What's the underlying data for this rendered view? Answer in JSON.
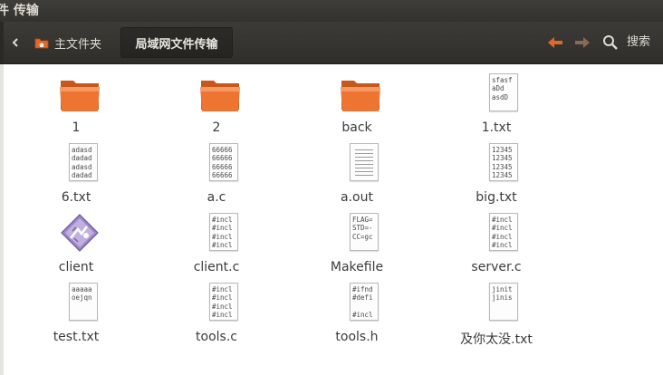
{
  "window": {
    "title": "件 传输"
  },
  "toolbar": {
    "breadcrumbs": [
      {
        "label": "主文件夹",
        "icon": "home-folder-icon"
      },
      {
        "label": "局域网文件传输",
        "active": true
      }
    ],
    "search_label": "搜索",
    "accent": "#e0692a"
  },
  "files": [
    {
      "name": "1",
      "kind": "folder"
    },
    {
      "name": "2",
      "kind": "folder"
    },
    {
      "name": "back",
      "kind": "folder"
    },
    {
      "name": "1.txt",
      "kind": "text",
      "preview": [
        "sfasf",
        "aDd",
        "asdD"
      ]
    },
    {
      "name": "6.txt",
      "kind": "text",
      "preview": [
        "adasd",
        "dadad",
        "adasd",
        "dadad"
      ]
    },
    {
      "name": "a.c",
      "kind": "text",
      "preview": [
        "66666",
        "66666",
        "66666",
        "66666"
      ]
    },
    {
      "name": "a.out",
      "kind": "binary"
    },
    {
      "name": "big.txt",
      "kind": "text",
      "preview": [
        "12345",
        "12345",
        "12345",
        "12345"
      ]
    },
    {
      "name": "client",
      "kind": "executable"
    },
    {
      "name": "client.c",
      "kind": "text",
      "preview": [
        "#incl",
        "#incl",
        "#incl",
        "#incl"
      ]
    },
    {
      "name": "Makefile",
      "kind": "text",
      "preview": [
        "FLAG=",
        "STD=-",
        "CC=gc"
      ]
    },
    {
      "name": "server.c",
      "kind": "text",
      "preview": [
        "#incl",
        "#incl",
        "#incl",
        "#incl"
      ]
    },
    {
      "name": "test.txt",
      "kind": "text",
      "preview": [
        "aaaaa",
        "oejqn"
      ]
    },
    {
      "name": "tools.c",
      "kind": "text",
      "preview": [
        "#incl",
        "#incl",
        "#incl",
        "#incl"
      ]
    },
    {
      "name": "tools.h",
      "kind": "text",
      "preview": [
        "#ifnd",
        "#defi",
        "",
        "#incl"
      ]
    },
    {
      "name": "及你太没.txt",
      "kind": "text",
      "preview": [
        "jinit",
        "jinis"
      ]
    }
  ]
}
